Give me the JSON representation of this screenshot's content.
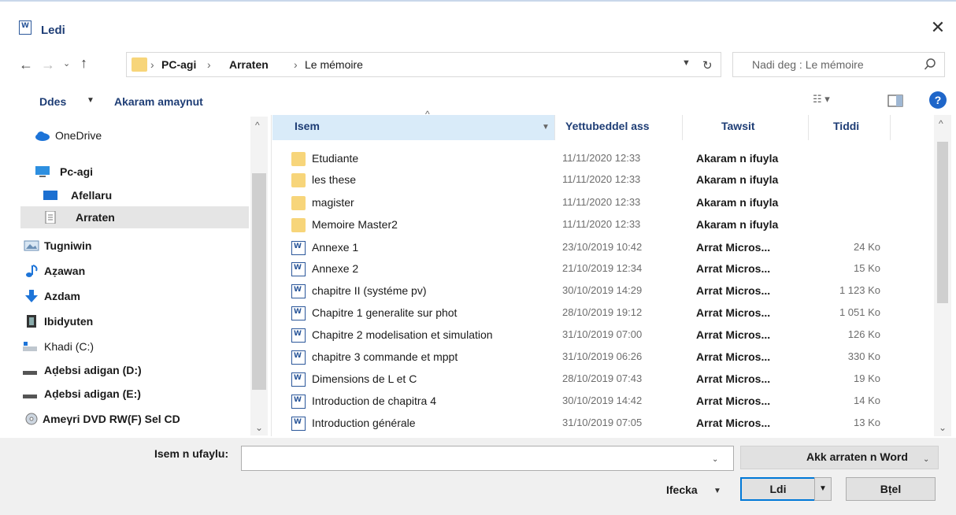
{
  "window": {
    "title": "Ledi",
    "close_label": "✕"
  },
  "address": {
    "crumbs": [
      "PC-agi",
      "Arraten",
      "Le mémoire"
    ],
    "separator": "›"
  },
  "search": {
    "placeholder": "Nadi deg : Le mémoire"
  },
  "toolbar": {
    "organize": "Ddes",
    "new_folder": "Akaram amaynut",
    "help": "?"
  },
  "sidebar": {
    "items": [
      {
        "label": "OneDrive",
        "icon": "cloud-icon",
        "bold": false
      },
      {
        "label": "Pc-agi",
        "icon": "computer-icon",
        "bold": true
      },
      {
        "label": "Afellaru",
        "icon": "desktop-icon",
        "bold": true
      },
      {
        "label": "Arraten",
        "icon": "documents-icon",
        "bold": true,
        "selected": true
      },
      {
        "label": "Tugniwin",
        "icon": "pictures-icon",
        "bold": true
      },
      {
        "label": "Aẓawan",
        "icon": "music-icon",
        "bold": true
      },
      {
        "label": "Azdam",
        "icon": "download-icon",
        "bold": true
      },
      {
        "label": "Ibidyuten",
        "icon": "video-icon",
        "bold": true
      },
      {
        "label": "Khadi (C:)",
        "icon": "drive-icon",
        "bold": false
      },
      {
        "label": "Aḍebsi adigan (D:)",
        "icon": "drive-icon",
        "bold": true
      },
      {
        "label": "Aḍebsi adigan (E:)",
        "icon": "drive-icon",
        "bold": true
      },
      {
        "label": "Ameγri DVD RW(F) Sel CD",
        "icon": "dvd-icon",
        "bold": true
      }
    ]
  },
  "columns": {
    "name": "Isem",
    "date": "Yettubeddel ass",
    "type": "Tawsit",
    "size": "Tiddi"
  },
  "files": [
    {
      "name": "Etudiante",
      "date": "11/11/2020 12:33",
      "type": "Akaram n ifuyla",
      "size": "",
      "kind": "folder"
    },
    {
      "name": "les these",
      "date": "11/11/2020 12:33",
      "type": "Akaram n ifuyla",
      "size": "",
      "kind": "folder"
    },
    {
      "name": "magister",
      "date": "11/11/2020 12:33",
      "type": "Akaram n ifuyla",
      "size": "",
      "kind": "folder"
    },
    {
      "name": "Memoire Master2",
      "date": "11/11/2020 12:33",
      "type": "Akaram n ifuyla",
      "size": "",
      "kind": "folder"
    },
    {
      "name": "Annexe 1",
      "date": "23/10/2019 10:42",
      "type": "Arrat Micros...",
      "size": "24 Ko",
      "kind": "word"
    },
    {
      "name": "Annexe 2",
      "date": "21/10/2019 12:34",
      "type": "Arrat Micros...",
      "size": "15 Ko",
      "kind": "word"
    },
    {
      "name": "chapitre  II (systéme pv)",
      "date": "30/10/2019 14:29",
      "type": "Arrat Micros...",
      "size": "1 123 Ko",
      "kind": "word"
    },
    {
      "name": "Chapitre 1 generalite sur phot",
      "date": "28/10/2019 19:12",
      "type": "Arrat Micros...",
      "size": "1 051 Ko",
      "kind": "word"
    },
    {
      "name": "Chapitre 2 modelisation et simulation",
      "date": "31/10/2019 07:00",
      "type": "Arrat Micros...",
      "size": "126 Ko",
      "kind": "word"
    },
    {
      "name": "chapitre 3 commande et mppt",
      "date": "31/10/2019 06:26",
      "type": "Arrat Micros...",
      "size": "330 Ko",
      "kind": "word"
    },
    {
      "name": "Dimensions de L et C",
      "date": "28/10/2019 07:43",
      "type": "Arrat Micros...",
      "size": "19 Ko",
      "kind": "word"
    },
    {
      "name": "Introduction de chapitra 4",
      "date": "30/10/2019 14:42",
      "type": "Arrat Micros...",
      "size": "14 Ko",
      "kind": "word"
    },
    {
      "name": "Introduction générale",
      "date": "31/10/2019 07:05",
      "type": "Arrat Micros...",
      "size": "13 Ko",
      "kind": "word"
    }
  ],
  "bottom": {
    "filename_label": "Isem n ufaylu:",
    "filename_value": "",
    "filetype": "Akk arraten n Word",
    "tools": "Ifecka",
    "open": "Ldi",
    "cancel": "Bṭel"
  },
  "colors": {
    "accent": "#1e3d75",
    "selection": "#d9ebf9",
    "primary_border": "#0078d7",
    "folder": "#f7d57a"
  }
}
